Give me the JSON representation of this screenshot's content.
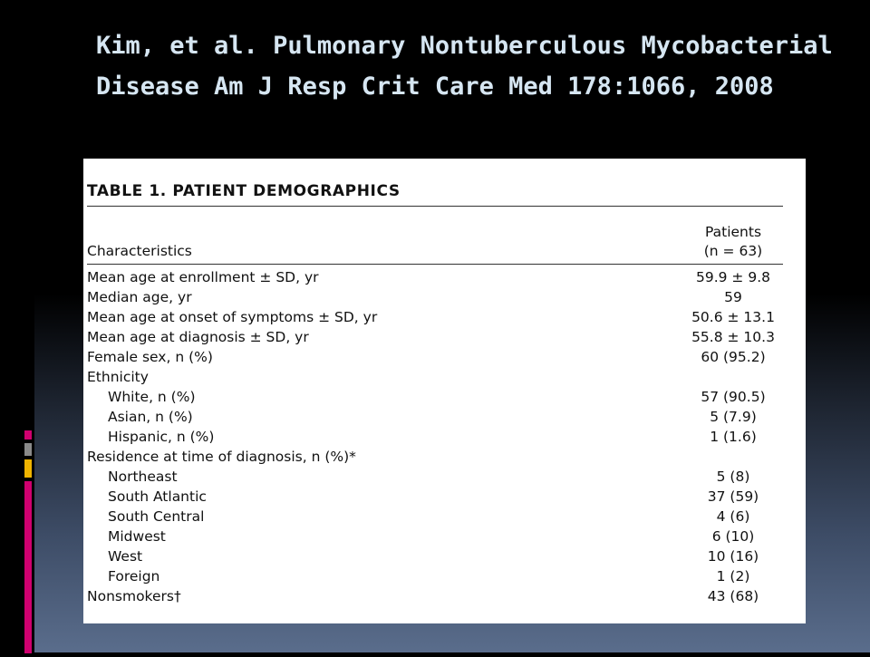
{
  "slide": {
    "title": "Kim, et al. Pulmonary Nontuberculous Mycobacterial Disease Am J Resp Crit Care Med 178:1066, 2008",
    "accent_colors": [
      "#d0006f",
      "#8a8a8a",
      "#f0b400",
      "#d0006f"
    ]
  },
  "table": {
    "caption": "TABLE 1. PATIENT DEMOGRAPHICS",
    "header": {
      "characteristics": "Characteristics",
      "patients": "Patients",
      "n_label": "(n = 63)"
    },
    "rows": [
      {
        "label": "Mean age at enrollment ± SD, yr",
        "value": "59.9 ± 9.8",
        "indent": false
      },
      {
        "label": "Median age, yr",
        "value": "59",
        "indent": false
      },
      {
        "label": "Mean age at onset of symptoms ± SD, yr",
        "value": "50.6 ± 13.1",
        "indent": false
      },
      {
        "label": "Mean age at diagnosis ± SD, yr",
        "value": "55.8 ± 10.3",
        "indent": false
      },
      {
        "label": "Female sex, n (%)",
        "value": "60 (95.2)",
        "indent": false
      },
      {
        "label": "Ethnicity",
        "value": "",
        "indent": false
      },
      {
        "label": "White, n (%)",
        "value": "57 (90.5)",
        "indent": true
      },
      {
        "label": "Asian, n (%)",
        "value": "5 (7.9)",
        "indent": true
      },
      {
        "label": "Hispanic, n (%)",
        "value": "1 (1.6)",
        "indent": true
      },
      {
        "label": "Residence at time of diagnosis, n (%)*",
        "value": "",
        "indent": false
      },
      {
        "label": "Northeast",
        "value": "5 (8)",
        "indent": true
      },
      {
        "label": "South Atlantic",
        "value": "37 (59)",
        "indent": true
      },
      {
        "label": "South Central",
        "value": "4 (6)",
        "indent": true
      },
      {
        "label": "Midwest",
        "value": "6 (10)",
        "indent": true
      },
      {
        "label": "West",
        "value": "10 (16)",
        "indent": true
      },
      {
        "label": "Foreign",
        "value": "1 (2)",
        "indent": true
      },
      {
        "label": "Nonsmokers†",
        "value": "43 (68)",
        "indent": false
      }
    ]
  }
}
